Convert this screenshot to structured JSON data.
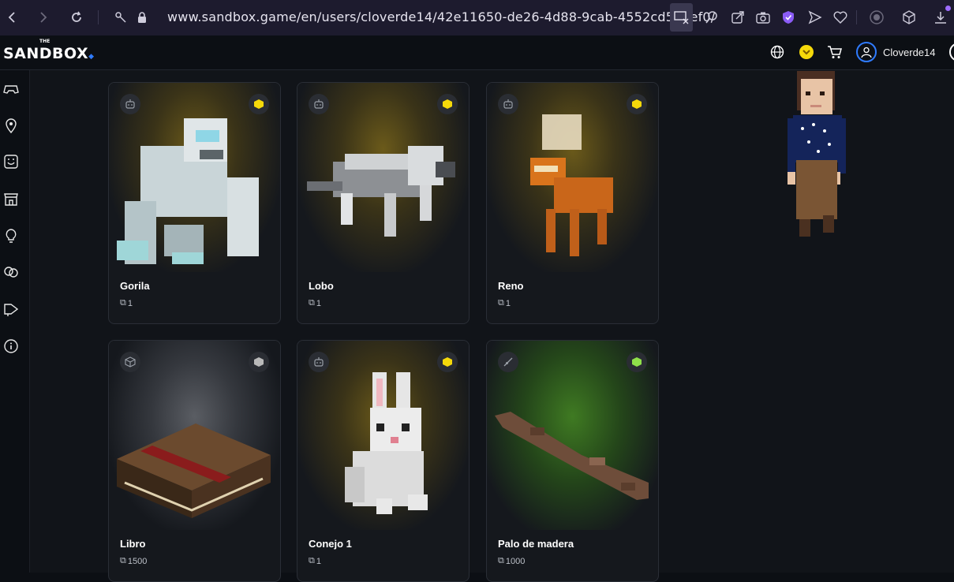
{
  "browser": {
    "url": "www.sandbox.game/en/users/cloverde14/42e11650-de26-4d88-9cab-4552cd5e8ef0/"
  },
  "header": {
    "logo_top": "THE",
    "logo": "SANDBOX",
    "username": "Cloverde14"
  },
  "cards": [
    {
      "title": "Gorila",
      "count": "1",
      "type_icon": "robot-icon",
      "rarity_color": "#f5d90a",
      "glow": "#6b5a1a"
    },
    {
      "title": "Lobo",
      "count": "1",
      "type_icon": "robot-icon",
      "rarity_color": "#f5d90a",
      "glow": "#6b5a1a"
    },
    {
      "title": "Reno",
      "count": "1",
      "type_icon": "robot-icon",
      "rarity_color": "#f5d90a",
      "glow": "#6b5a1a"
    },
    {
      "title": "Libro",
      "count": "1500",
      "type_icon": "cube-outline-icon",
      "rarity_color": "#b9b9b9",
      "glow": "#4a4d55"
    },
    {
      "title": "Conejo 1",
      "count": "1",
      "type_icon": "robot-icon",
      "rarity_color": "#f5d90a",
      "glow": "#6b5a1a"
    },
    {
      "title": "Palo de madera",
      "count": "1000",
      "type_icon": "brush-icon",
      "rarity_color": "#8fe04a",
      "glow": "#2f5a1c"
    }
  ],
  "colors": {
    "accent": "#2f7bff",
    "coin": "#f5d90a"
  }
}
